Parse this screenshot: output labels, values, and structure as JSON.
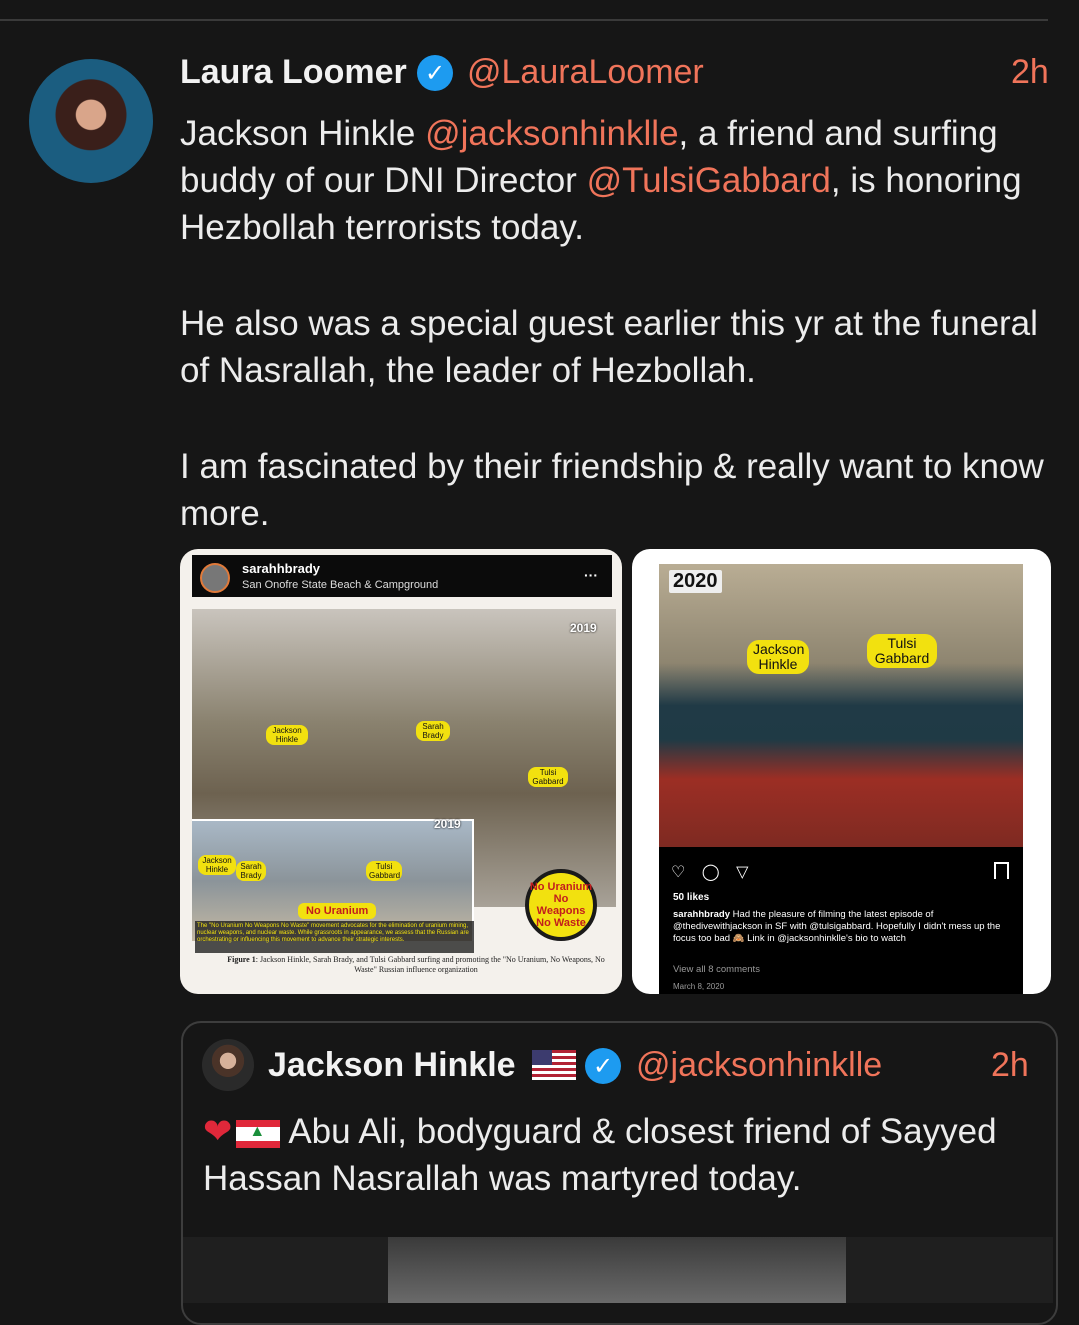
{
  "post": {
    "author_name": "Laura Loomer",
    "author_handle": "@LauraLoomer",
    "time": "2h",
    "line1_pre": "Jackson Hinkle ",
    "mention1": "@jacksonhinklle",
    "line1_post": ", a friend and surfing buddy of our DNI Director ",
    "mention2": "@TulsiGabbard",
    "line1_end": ", is honoring Hezbollah terrorists today.",
    "paragraph2": "He also was a special guest earlier this yr at the funeral of Nasrallah, the leader of Hezbollah.",
    "paragraph3": "I am fascinated by their friendship & really want to know more."
  },
  "image_left": {
    "ig_user": "sarahhbrady",
    "ig_location": "San Onofre State Beach & Campground",
    "ig_more": "···",
    "year_top": "2019",
    "year_inset": "2019",
    "tag_jackson": "Jackson Hinkle",
    "tag_sarah": "Sarah Brady",
    "tag_tulsi": "Tulsi Gabbard",
    "tag_jackson2": "Jackson Hinkle",
    "tag_sarah2": "Sarah Brady",
    "tag_tulsi2": "Tulsi Gabbard",
    "banner": "No Uranium",
    "logo": "No Uranium No Weapons No Waste",
    "box_text": "The \"No Uranium No Weapons No Waste\" movement advocates for the elimination of uranium mining, nuclear weapons, and nuclear waste. While grassroots in appearance, we assess that the Russian are orchestrating or influencing this movement to advance their strategic interests.",
    "caption_label": "Figure 1",
    "caption": ": Jackson Hinkle, Sarah Brady, and Tulsi Gabbard surfing and promoting the \"No Uranium, No Weapons, No Waste\" Russian influence organization"
  },
  "image_right": {
    "year": "2020",
    "tag_jackson": "Jackson Hinkle",
    "tag_tulsi": "Tulsi Gabbard",
    "action_icons": "♡ ◯ ▽",
    "likes": "50 likes",
    "caption_user": "sarahhbrady",
    "caption": " Had the pleasure of filming the latest episode of @thedivewithjackson in SF with @tulsigabbard. Hopefully I didn't mess up the focus too bad 🙈 Link in @jacksonhinklle's bio to watch",
    "view_comments": "View all 8 comments",
    "date": "March 8, 2020"
  },
  "quoted": {
    "author_name": "Jackson Hinkle",
    "author_handle": "@jacksonhinklle",
    "time": "2h",
    "heart": "❤",
    "text": "Abu Ali, bodyguard & closest friend of Sayyed Hassan Nasrallah was martyred today."
  },
  "colors": {
    "background": "#161616",
    "accent": "#f0745a",
    "verified": "#1d9bf0"
  }
}
